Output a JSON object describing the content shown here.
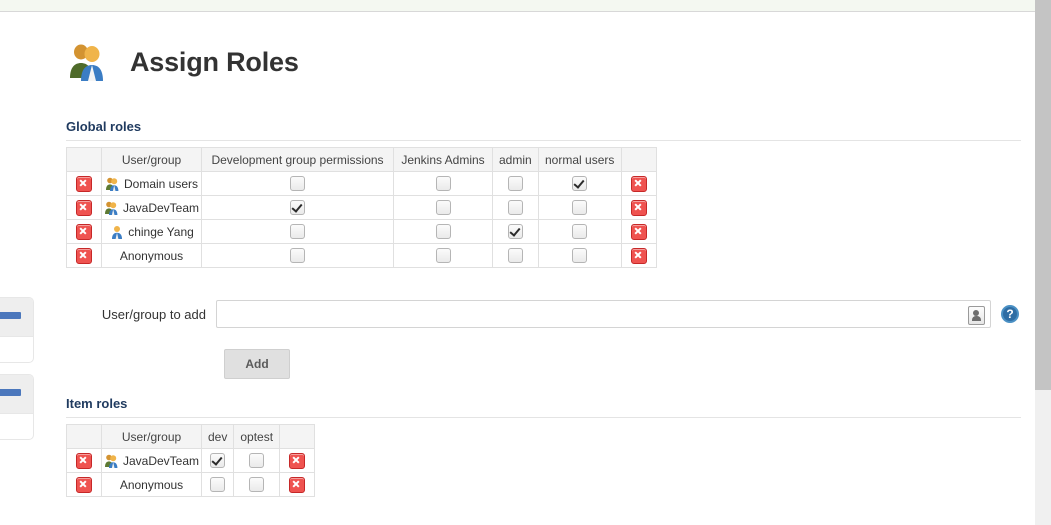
{
  "page": {
    "title": "Assign Roles",
    "title_icon": "people-group-icon"
  },
  "sections": {
    "global": {
      "heading": "Global roles"
    },
    "item": {
      "heading": "Item roles"
    }
  },
  "global_roles_table": {
    "columns": [
      "User/group",
      "Development group permissions",
      "Jenkins Admins",
      "admin",
      "normal users"
    ],
    "rows": [
      {
        "name": "Domain users",
        "icon": "group-icon",
        "checks": [
          false,
          false,
          false,
          true
        ]
      },
      {
        "name": "JavaDevTeam",
        "icon": "group-icon",
        "checks": [
          true,
          false,
          false,
          false
        ]
      },
      {
        "name": "chinge Yang",
        "icon": "user-icon",
        "checks": [
          false,
          false,
          true,
          false
        ]
      },
      {
        "name": "Anonymous",
        "icon": "none",
        "checks": [
          false,
          false,
          false,
          false
        ]
      }
    ],
    "delete_icon": "delete-icon"
  },
  "item_roles_table": {
    "columns": [
      "User/group",
      "dev",
      "optest"
    ],
    "rows": [
      {
        "name": "JavaDevTeam",
        "icon": "group-icon",
        "checks": [
          true,
          false
        ]
      },
      {
        "name": "Anonymous",
        "icon": "none",
        "checks": [
          false,
          false
        ]
      }
    ],
    "delete_icon": "delete-icon"
  },
  "add_form": {
    "label": "User/group to add",
    "input_value": "",
    "input_placeholder": "",
    "picker_icon": "contact-picker-icon",
    "help_icon": "help-icon",
    "help_glyph": "?",
    "add_label": "Add"
  },
  "colors": {
    "accent_blue": "#2e6da4",
    "heading_navy": "#1f3a5f",
    "delete_red": "#ef5350",
    "sidebar_bar_blue": "#4b77bc",
    "top_strip": "#f4f8f1"
  }
}
